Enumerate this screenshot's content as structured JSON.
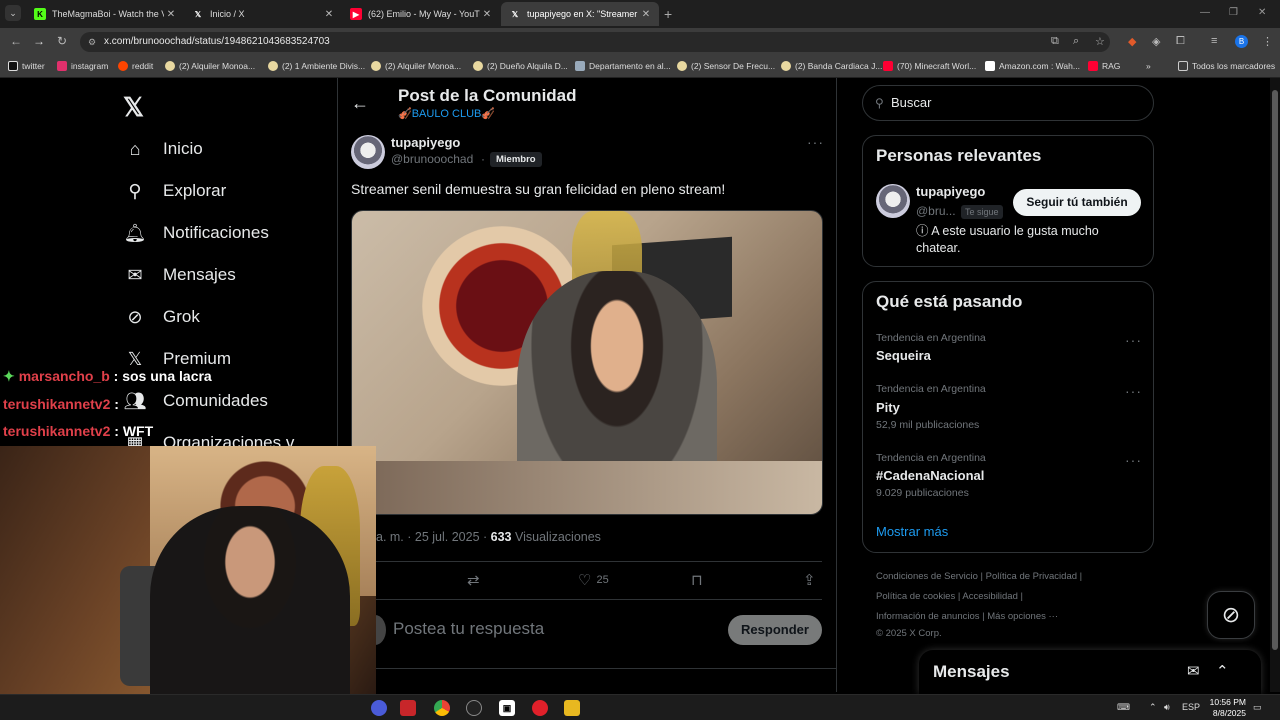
{
  "browser": {
    "tabs": [
      {
        "title": "TheMagmaBoi - Watch the VOD",
        "favicon": "kick-icon",
        "color": "#53fc18",
        "active": false
      },
      {
        "title": "Inicio / X",
        "favicon": "x-icon",
        "color": "#ffffff",
        "active": false
      },
      {
        "title": "(62) Emilio - My Way - YouTube",
        "favicon": "youtube-icon",
        "color": "#ff0033",
        "active": false
      },
      {
        "title": "tupapiyego en X: \"Streamer senil",
        "favicon": "x-icon",
        "color": "#ffffff",
        "active": true
      }
    ],
    "url": "x.com/brunooochad/status/1948621043683524703",
    "bookmarks": [
      {
        "label": "twitter",
        "color": "#ffffff"
      },
      {
        "label": "instagram",
        "color": "#e1306c"
      },
      {
        "label": "reddit",
        "color": "#ff4500"
      },
      {
        "label": "(2) Alquiler Monoa...",
        "color": "#e8d8a0"
      },
      {
        "label": "(2) 1 Ambiente Divis...",
        "color": "#e8d8a0"
      },
      {
        "label": "(2) Alquiler Monoa...",
        "color": "#e8d8a0"
      },
      {
        "label": "(2) Dueño Alquila D...",
        "color": "#e8d8a0"
      },
      {
        "label": "Departamento en al...",
        "color": "#9ab"
      },
      {
        "label": "(2) Sensor De Frecu...",
        "color": "#e8d8a0"
      },
      {
        "label": "(2) Banda Cardiaca J...",
        "color": "#e8d8a0"
      },
      {
        "label": "(70) Minecraft Worl...",
        "color": "#ff0033"
      },
      {
        "label": "Amazon.com : Wah...",
        "color": "#ffffff"
      },
      {
        "label": "RAG",
        "color": "#ff0033"
      }
    ],
    "all_bookmarks": "Todos los marcadores",
    "profile_initial": "B"
  },
  "x": {
    "logo": "𝕏",
    "nav": [
      {
        "label": "Inicio",
        "icon": "home-icon"
      },
      {
        "label": "Explorar",
        "icon": "search-icon"
      },
      {
        "label": "Notificaciones",
        "icon": "bell-icon"
      },
      {
        "label": "Mensajes",
        "icon": "mail-icon"
      },
      {
        "label": "Grok",
        "icon": "grok-icon"
      },
      {
        "label": "Premium",
        "icon": "x-icon"
      },
      {
        "label": "Comunidades",
        "icon": "communities-icon"
      },
      {
        "label": "Organizaciones v",
        "icon": "organizations-icon"
      }
    ],
    "header": {
      "title": "Post de la Comunidad",
      "community": "🎻BAULO CLUB🎻"
    },
    "post": {
      "author_name": "tupapiyego",
      "author_handle": "@brunooochad",
      "badge": "Miembro",
      "text": "Streamer senil demuestra su gran felicidad en pleno stream!",
      "meta_prefix": "a. m. · 25 jul. 2025 ·",
      "views": "633",
      "views_label": "Visualizaciones",
      "likes": "25"
    },
    "reply": {
      "placeholder": "Postea tu respuesta",
      "button": "Responder"
    },
    "search_placeholder": "Buscar",
    "relevant": {
      "title": "Personas relevantes",
      "name": "tupapiyego",
      "handle": "@bru...",
      "follows_you": "Te sigue",
      "follow_button": "Seguir tú también",
      "bio": "ⓘ A este usuario le gusta mucho chatear."
    },
    "trends": {
      "title": "Qué está pasando",
      "items": [
        {
          "context": "Tendencia en Argentina",
          "name": "Sequeira",
          "count": ""
        },
        {
          "context": "Tendencia en Argentina",
          "name": "Pity",
          "count": "52,9 mil publicaciones"
        },
        {
          "context": "Tendencia en Argentina",
          "name": "#CadenaNacional",
          "count": "9.029 publicaciones"
        }
      ],
      "show_more": "Mostrar más"
    },
    "footer": {
      "line1": "Condiciones de Servicio  |  Política de Privacidad  |",
      "line2": "Política de cookies  |  Accesibilidad  |",
      "line3": "Información de anuncios  |  Más opciones ···",
      "line4": "© 2025 X Corp."
    },
    "messages_drawer": "Mensajes"
  },
  "stream_chat": [
    {
      "user": "marsancho_b",
      "message": ": sos una lacra",
      "badge": true
    },
    {
      "user": "terushikannetv2",
      "message": ":",
      "badge": false
    },
    {
      "user": "terushikannetv2",
      "message": ": WFT",
      "badge": false
    }
  ],
  "taskbar": {
    "lang": "ESP",
    "time": "10:56 PM",
    "date": "8/8/2025"
  }
}
